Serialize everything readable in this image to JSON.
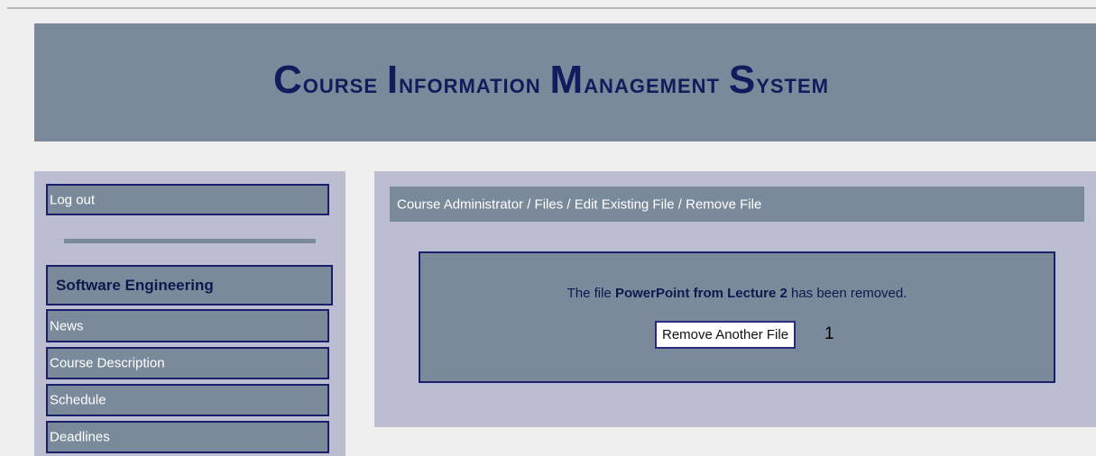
{
  "header": {
    "title_words": [
      {
        "initial": "C",
        "rest": "ourse"
      },
      {
        "initial": "I",
        "rest": "nformation"
      },
      {
        "initial": "M",
        "rest": "anagement"
      },
      {
        "initial": "S",
        "rest": "ystem"
      }
    ]
  },
  "sidebar": {
    "logout_label": "Log out",
    "section_title": "Software Engineering",
    "items": [
      {
        "label": "News"
      },
      {
        "label": "Course Description"
      },
      {
        "label": "Schedule"
      },
      {
        "label": "Deadlines"
      }
    ]
  },
  "main": {
    "breadcrumb": "Course Administrator / Files / Edit Existing File / Remove File",
    "message_prefix": "The file ",
    "file_name": "PowerPoint from Lecture 2",
    "message_suffix": " has been removed.",
    "remove_another_label": "Remove Another File",
    "button_annotation": "1"
  },
  "colors": {
    "panel_gray": "#7a8a9a",
    "lavender": "#bcbdd0",
    "navy": "#1a1f6a"
  }
}
